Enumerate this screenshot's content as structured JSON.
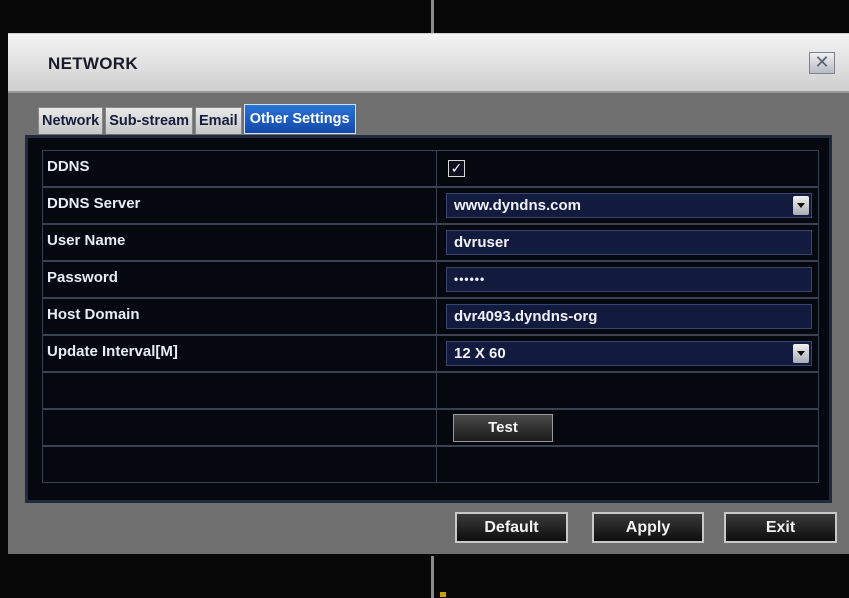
{
  "dialog": {
    "title": "NETWORK",
    "close_icon": "close-x-icon"
  },
  "tabs": [
    {
      "label": "Network",
      "active": false
    },
    {
      "label": "Sub-stream",
      "active": false
    },
    {
      "label": "Email",
      "active": false
    },
    {
      "label": "Other Settings",
      "active": true
    }
  ],
  "settings": {
    "ddns": {
      "label": "DDNS",
      "checked": true,
      "check_glyph": "✓"
    },
    "ddns_server": {
      "label": "DDNS Server",
      "value": "www.dyndns.com"
    },
    "user_name": {
      "label": "User Name",
      "value": "dvruser"
    },
    "password": {
      "label": "Password",
      "value": "••••••"
    },
    "host_domain": {
      "label": "Host Domain",
      "value": "dvr4093.dyndns-org"
    },
    "update_interval": {
      "label": "Update Interval[M]",
      "value": "12 X 60"
    }
  },
  "test_button": "Test",
  "footer": {
    "default_label": "Default",
    "apply_label": "Apply",
    "exit_label": "Exit"
  },
  "colors": {
    "active_tab": "#1f5fc4",
    "panel_bg": "#05080f",
    "field_bg": "#121a3e"
  }
}
